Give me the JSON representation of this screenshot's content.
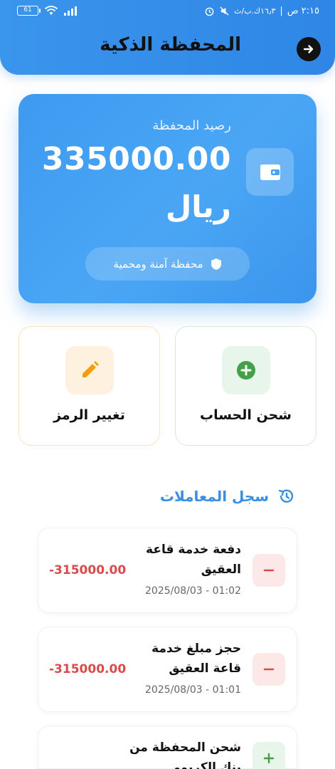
{
  "status_bar": {
    "battery": "61",
    "time": "٢:١٥ ص",
    "network_text": "١٦٫٣ك.ب/ث"
  },
  "header": {
    "title": "المحفظة الذكية"
  },
  "balance_card": {
    "label": "رصيد المحفظة",
    "amount": "335000.00",
    "currency": "ريال",
    "secure_text": "محفظة آمنة ومحمية"
  },
  "actions": {
    "recharge_label": "شحن الحساب",
    "change_pin_label": "تغيير الرمز"
  },
  "history": {
    "title": "سجل المعاملات",
    "transactions": [
      {
        "title": "دفعة خدمة قاعة العقيق",
        "date": "2025/08/03 - 01:02",
        "amount": "-315000.00",
        "type": "debit"
      },
      {
        "title": "حجز مبلغ خدمة قاعة العقيق",
        "date": "2025/08/03 - 01:01",
        "amount": "-315000.00",
        "type": "debit"
      },
      {
        "title": "شحن المحفظة من بنك الكريمي",
        "date": "",
        "amount": "",
        "type": "credit"
      }
    ]
  },
  "colors": {
    "primary": "#3a95ec",
    "debit": "#d94a4a",
    "credit": "#43a047",
    "pin_accent": "#f59e0b"
  }
}
